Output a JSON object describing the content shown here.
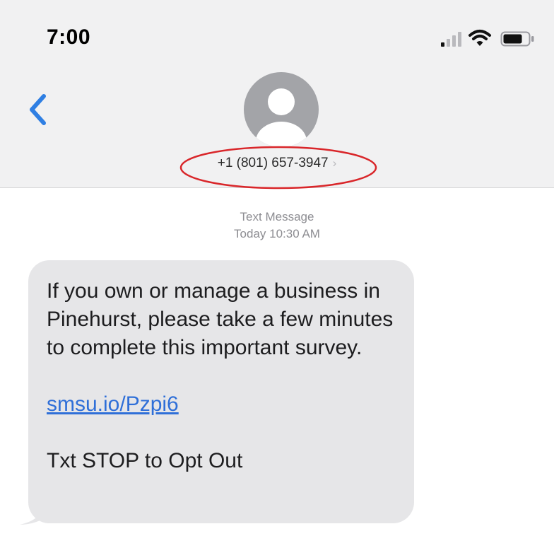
{
  "status_bar": {
    "time": "7:00",
    "icons": [
      "signal-icon",
      "wifi-icon",
      "battery-icon"
    ]
  },
  "nav": {
    "back_icon": "chevron-left-icon",
    "avatar_icon": "person-icon",
    "contact_number": "+1 (801) 657-3947",
    "contact_chevron": "›"
  },
  "message_meta": {
    "type": "Text Message",
    "timestamp": "Today 10:30 AM"
  },
  "message": {
    "body": "If you own or manage a business in Pinehurst, please take a few minutes to complete this important survey.",
    "link": "smsu.io/Pzpi6",
    "footer": "Txt STOP to Opt Out"
  },
  "colors": {
    "header_bg": "#f1f1f2",
    "bubble_bg": "#e6e6e8",
    "accent_blue": "#2f7fe3",
    "link_blue": "#2f6fd8",
    "annotation_red": "#d9262a",
    "avatar_gray": "#a3a4a8"
  }
}
